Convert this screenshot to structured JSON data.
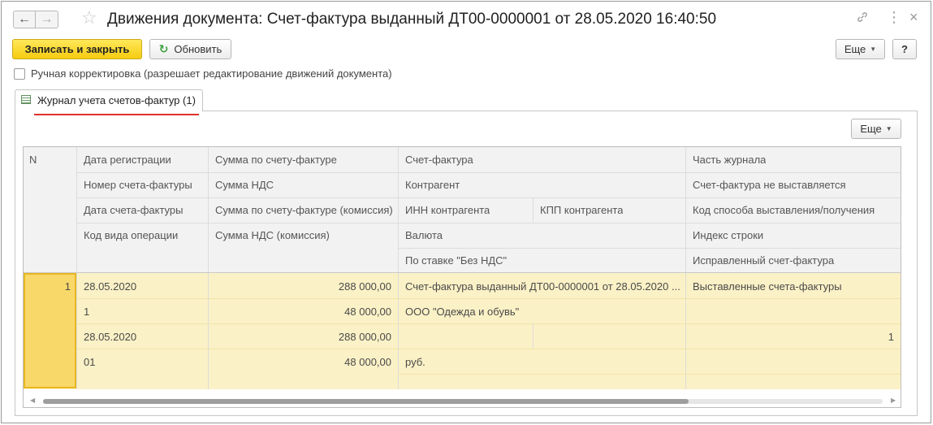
{
  "window": {
    "title": "Движения документа: Счет-фактура выданный ДТ00-0000001 от 28.05.2020 16:40:50",
    "nav_back": "←",
    "nav_forward": "→",
    "star_icon": "☆",
    "link_icon": "🔗",
    "more_icon": "⋮",
    "close_icon": "×"
  },
  "toolbar": {
    "save_close_label": "Записать и закрыть",
    "refresh_label": "Обновить",
    "refresh_icon": "↻",
    "more_label": "Еще",
    "help_label": "?"
  },
  "manual_edit": {
    "label": "Ручная корректировка (разрешает редактирование движений документа)",
    "checked": false
  },
  "tab": {
    "label": "Журнал учета счетов-фактур (1)",
    "icon": "table-icon"
  },
  "panel": {
    "more_label": "Еще"
  },
  "table": {
    "headers": {
      "n": "N",
      "c1": [
        "Дата регистрации",
        "Номер счета-фактуры",
        "Дата счета-фактуры",
        "Код вида операции"
      ],
      "c2": [
        "Сумма по счету-фактуре",
        "Сумма НДС",
        "Сумма по счету-фактуре (комиссия)",
        "Сумма НДС (комиссия)"
      ],
      "c3": [
        "Счет-фактура",
        "Контрагент",
        "ИНН контрагента",
        "КПП контрагента",
        "Валюта",
        "По ставке \"Без НДС\""
      ],
      "c4": [
        "Часть журнала",
        "Счет-фактура не выставляется",
        "Код способа выставления/получения",
        "Индекс строки",
        "Исправленный счет-фактура"
      ]
    },
    "row": {
      "n": "1",
      "c1": [
        "28.05.2020",
        "1",
        "28.05.2020",
        "01"
      ],
      "c2": [
        "288 000,00",
        "48 000,00",
        "288 000,00",
        "48 000,00"
      ],
      "c3": [
        "Счет-фактура выданный ДТ00-0000001 от 28.05.2020 ...",
        "ООО \"Одежда и обувь\"",
        "",
        "",
        "руб.",
        ""
      ],
      "c4": [
        "Выставленные счета-фактуры",
        "",
        "1",
        "",
        ""
      ]
    }
  },
  "colors": {
    "primary_button": "#f6cb10",
    "row_highlight": "#fbf1c6",
    "selected_cell": "#f9d86a",
    "tab_underline": "#e0302c"
  }
}
